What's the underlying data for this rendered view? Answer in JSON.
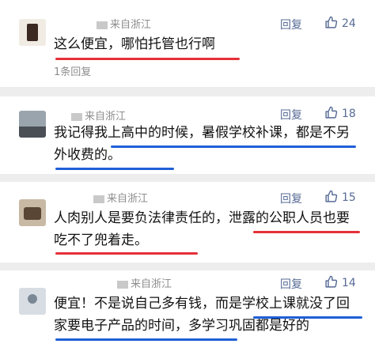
{
  "comments": [
    {
      "name": "来自浙江",
      "reply": "回复",
      "likes": "24",
      "text": "这么便宜，哪怕托管也行啊",
      "sub": "1条回复"
    },
    {
      "name": "来自浙江",
      "reply": "回复",
      "likes": "18",
      "text": "我记得我上高中的时候，暑假学校补课，都是不另外收费的。"
    },
    {
      "name": "来自浙江",
      "reply": "回复",
      "likes": "15",
      "text": "人肉别人是要负法律责任的，泄露的公职人员也要吃不了兜着走。"
    },
    {
      "name": "来自浙江",
      "reply": "回复",
      "likes": "14",
      "text": "便宜！不是说自己多有钱，而是学校上课就没了回家要电子产品的时间，多学习巩固都是好的"
    }
  ],
  "colors": {
    "link": "#576b95",
    "underline_red": "#e5303a",
    "underline_blue": "#1f5fd6"
  },
  "icons": [
    "thumb-up-icon"
  ]
}
